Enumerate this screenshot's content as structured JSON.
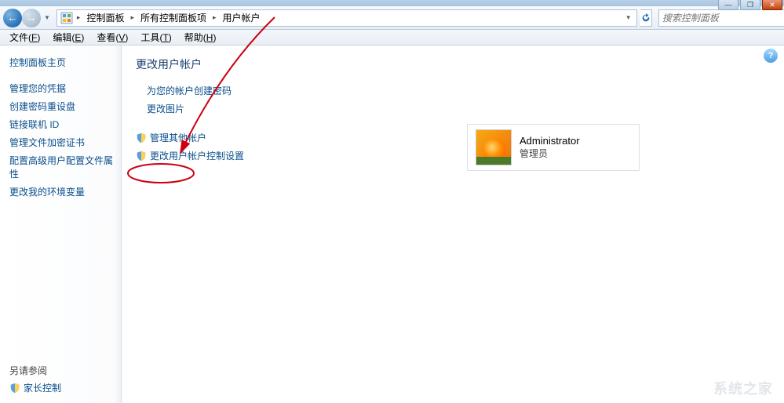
{
  "window": {
    "controls": {
      "min": "—",
      "max": "❐",
      "close": "✕"
    }
  },
  "breadcrumb": {
    "items": [
      "控制面板",
      "所有控制面板项",
      "用户帐户"
    ]
  },
  "search": {
    "placeholder": "搜索控制面板"
  },
  "menubar": {
    "items": [
      {
        "label": "文件",
        "accel": "F"
      },
      {
        "label": "编辑",
        "accel": "E"
      },
      {
        "label": "查看",
        "accel": "V"
      },
      {
        "label": "工具",
        "accel": "T"
      },
      {
        "label": "帮助",
        "accel": "H"
      }
    ]
  },
  "sidebar": {
    "home": "控制面板主页",
    "links": [
      "管理您的凭据",
      "创建密码重设盘",
      "链接联机 ID",
      "管理文件加密证书",
      "配置高级用户配置文件属性",
      "更改我的环境变量"
    ],
    "see_also": "另请参阅",
    "footer": "家长控制"
  },
  "content": {
    "title": "更改用户帐户",
    "tasks_primary": [
      "为您的帐户创建密码",
      "更改图片"
    ],
    "tasks_shield": [
      "管理其他帐户",
      "更改用户帐户控制设置"
    ]
  },
  "account": {
    "name": "Administrator",
    "role": "管理员"
  },
  "watermark": "系统之家"
}
